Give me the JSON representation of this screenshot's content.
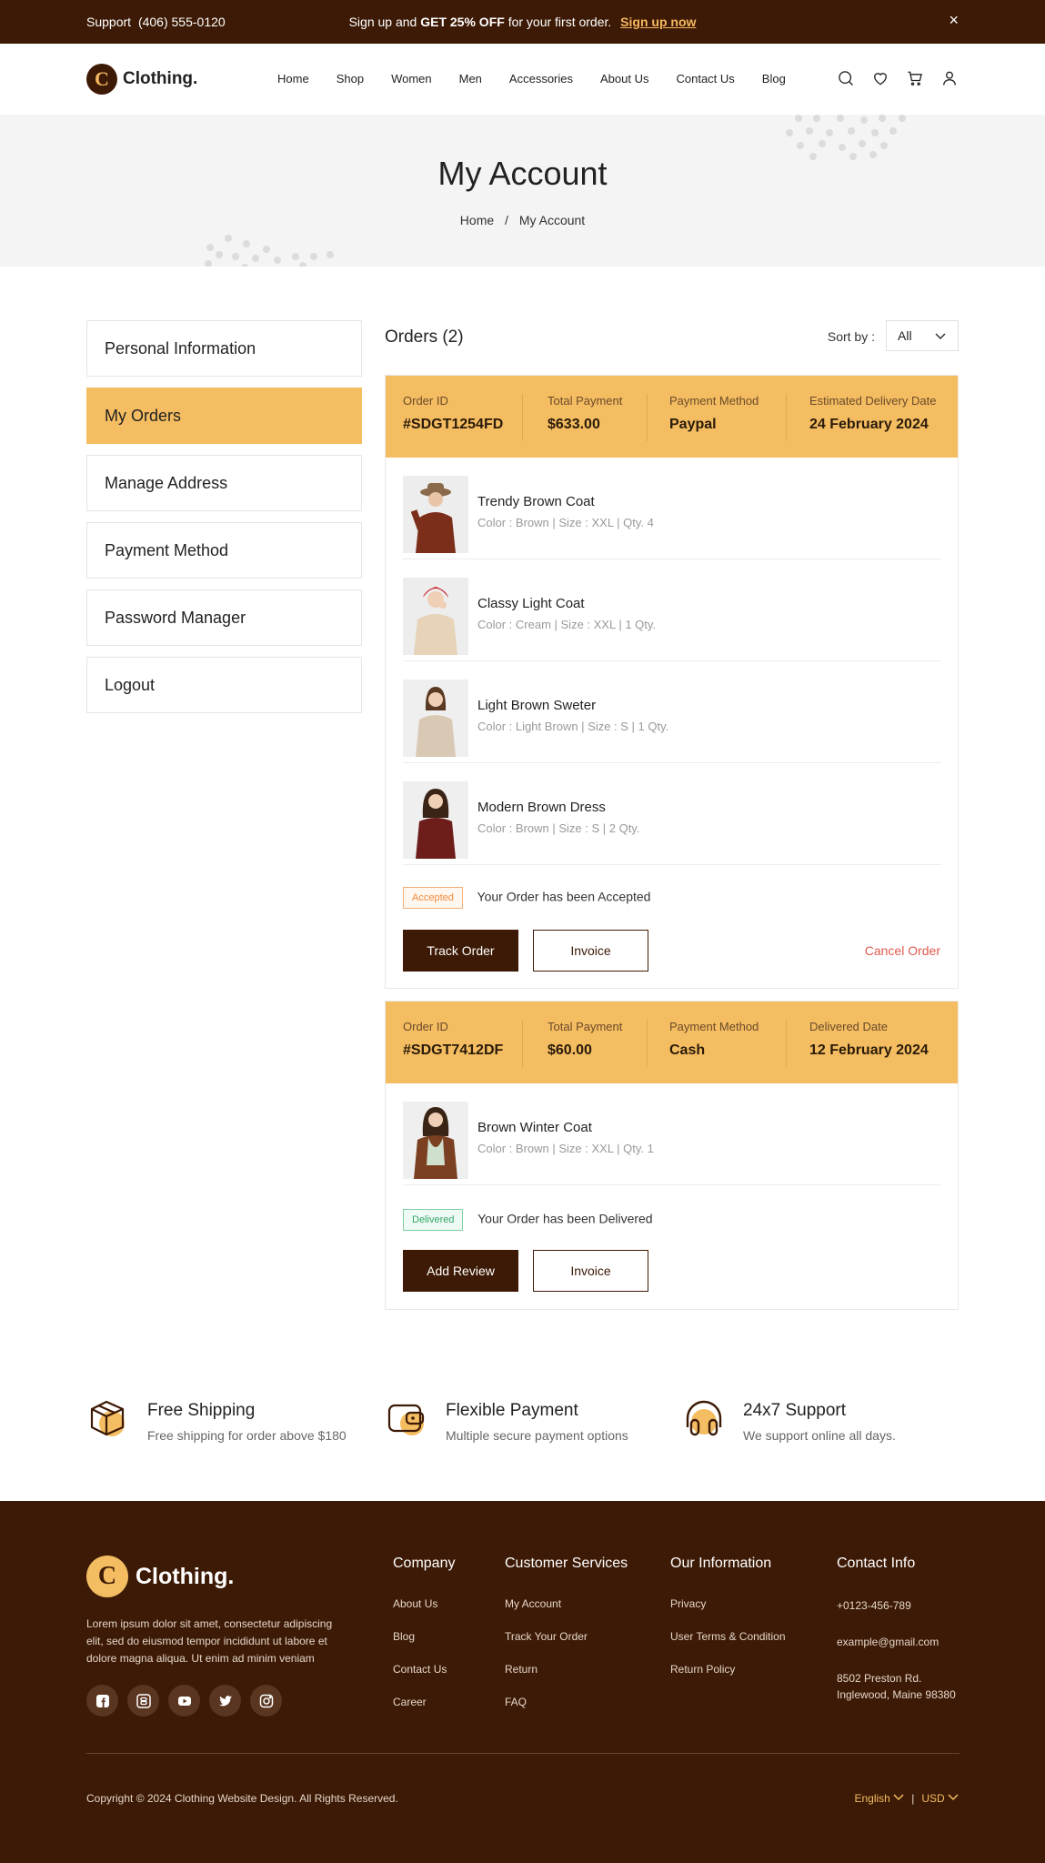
{
  "topbar": {
    "support_label": "Support",
    "support_phone": "(406) 555-0120",
    "promo_prefix": "Sign up and",
    "promo_bold": "GET 25% OFF",
    "promo_suffix": "for your first order.",
    "promo_link": "Sign up now",
    "close_icon": "×"
  },
  "brand": {
    "mark": "C",
    "name": "Clothing."
  },
  "nav": {
    "items": [
      "Home",
      "Shop",
      "Women",
      "Men",
      "Accessories",
      "About Us",
      "Contact Us",
      "Blog"
    ],
    "icons": [
      "search-icon",
      "heart-icon",
      "cart-icon",
      "user-icon"
    ]
  },
  "hero": {
    "title": "My Account",
    "crumb_home": "Home",
    "crumb_sep": "/",
    "crumb_current": "My Account"
  },
  "sidebar": {
    "items": [
      "Personal Information",
      "My Orders",
      "Manage Address",
      "Payment Method",
      "Password Manager",
      "Logout"
    ],
    "active": "My Orders"
  },
  "orders": {
    "title": "Orders (2)",
    "sort_label": "Sort by :",
    "sort_value": "All",
    "list": [
      {
        "labels": [
          "Order ID",
          "Total Payment",
          "Payment Method",
          "Estimated Delivery Date"
        ],
        "values": [
          "#SDGT1254FD",
          "$633.00",
          "Paypal",
          "24 February 2024"
        ],
        "items": [
          {
            "name": "Trendy Brown Coat",
            "meta": "Color : Brown | Size : XXL | Qty. 4"
          },
          {
            "name": "Classy Light Coat",
            "meta": "Color : Cream | Size : XXL | 1 Qty."
          },
          {
            "name": "Light Brown Sweter",
            "meta": "Color : Light Brown | Size : S | 1 Qty."
          },
          {
            "name": "Modern Brown Dress",
            "meta": "Color :  Brown | Size : S | 2 Qty."
          }
        ],
        "status_badge": "Accepted",
        "status_text": "Your Order has been Accepted",
        "primary_btn": "Track Order",
        "secondary_btn": "Invoice",
        "cancel": "Cancel Order"
      },
      {
        "labels": [
          "Order ID",
          "Total Payment",
          "Payment Method",
          "Delivered Date"
        ],
        "values": [
          "#SDGT7412DF",
          "$60.00",
          "Cash",
          "12 February 2024"
        ],
        "items": [
          {
            "name": "Brown Winter Coat",
            "meta": "Color : Brown | Size : XXL | Qty. 1"
          }
        ],
        "status_badge": "Delivered",
        "status_text": "Your Order has been Delivered",
        "primary_btn": "Add Review",
        "secondary_btn": "Invoice"
      }
    ]
  },
  "features": [
    {
      "title": "Free Shipping",
      "sub": "Free shipping for order above $180",
      "icon": "box-icon"
    },
    {
      "title": "Flexible Payment",
      "sub": "Multiple secure payment options",
      "icon": "wallet-icon"
    },
    {
      "title": "24x7 Support",
      "sub": "We support online all days.",
      "icon": "headset-icon"
    }
  ],
  "footer": {
    "desc": "Lorem ipsum dolor sit amet, consectetur adipiscing elit, sed do eiusmod tempor incididunt ut labore et dolore magna aliqua. Ut enim ad minim veniam",
    "socials": [
      "facebook-icon",
      "blogger-icon",
      "youtube-icon",
      "twitter-icon",
      "instagram-icon"
    ],
    "company": {
      "title": "Company",
      "links": [
        "About Us",
        "Blog",
        "Contact Us",
        "Career"
      ]
    },
    "services": {
      "title": "Customer Services",
      "links": [
        "My Account",
        "Track Your Order",
        "Return",
        "FAQ"
      ]
    },
    "info": {
      "title": "Our Information",
      "links": [
        "Privacy",
        "User Terms & Condition",
        "Return Policy"
      ]
    },
    "contact": {
      "title": "Contact Info",
      "phone": "+0123-456-789",
      "email": "example@gmail.com",
      "address": "8502 Preston Rd. Inglewood, Maine 98380"
    },
    "copyright": "Copyright © 2024 Clothing Website Design. All Rights Reserved.",
    "language": "English",
    "separator": "|",
    "currency": "USD"
  },
  "colors": {
    "brown": "#3d1a05",
    "accent": "#f4bd61",
    "cancel": "#e05a4f"
  }
}
